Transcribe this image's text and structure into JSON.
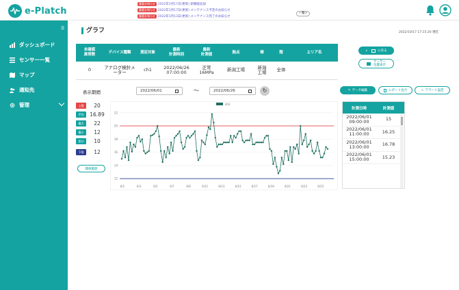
{
  "header": {
    "logo_text": "e-Platch",
    "notices": [
      {
        "tag": "重要お知らせ",
        "text": "2022年1月17日(更新) 新機能追加"
      },
      {
        "tag": "重要お知らせ",
        "text": "2022年1月17日(更新) メンテナンス予定のお知らせ"
      },
      {
        "tag": "重要お知らせ",
        "text": "2022年1月13日(更新) メンテナンス完了のお知らせ"
      }
    ],
    "list_button": "一覧>"
  },
  "sidebar": {
    "items": [
      {
        "label": "ダッシュボード",
        "icon": "bar-chart-icon"
      },
      {
        "label": "センサー一覧",
        "icon": "list-icon"
      },
      {
        "label": "マップ",
        "icon": "map-icon"
      },
      {
        "label": "通知先",
        "icon": "users-icon"
      },
      {
        "label": "管理",
        "icon": "gear-icon"
      }
    ]
  },
  "page": {
    "title": "グラフ",
    "datestamp": "2022/10/17 17:15:20",
    "datestamp_suffix": "現在"
  },
  "device_table": {
    "headers": [
      "未確認\n異常数",
      "デバイス種類",
      "測定対象",
      "最新\n計測時刻",
      "最新\n計測値",
      "拠点",
      "棟",
      "階",
      "エリア名"
    ],
    "row": [
      "0",
      "アナログ検針メーター",
      "ch1",
      "2022/06/26\n07:00:00",
      "正常\n16MPa",
      "新潟工場",
      "新潟\n工場",
      "全体",
      ""
    ]
  },
  "buttons": {
    "back": "に戻る",
    "sensor_location": "サンサー\n位置表示",
    "data_edit": "データ編集",
    "report_output": "レポート出力",
    "alert_setting": "アラート設定",
    "history": "閾値履歴"
  },
  "period": {
    "label": "表示期間",
    "start": "2022/06/01",
    "end": "2022/06/26",
    "separator": "〜"
  },
  "stats": [
    {
      "label": "上限",
      "value": "20",
      "color": "#e34747"
    },
    {
      "label": "平均",
      "value": "16.89",
      "color": "#14a3a0"
    },
    {
      "label": "最大",
      "value": "22",
      "color": "#14a3a0"
    },
    {
      "label": "最小",
      "value": "12",
      "color": "#14a3a0"
    },
    {
      "label": "差分",
      "value": "10",
      "color": "#14a3a0"
    },
    {
      "label": "下限",
      "value": "12",
      "color": "#2b3d8f"
    }
  ],
  "readings_table": {
    "headers": [
      "計測日時",
      "計測値"
    ],
    "rows": [
      {
        "time": "2022/06/01\n09:00:00",
        "value": "15"
      },
      {
        "time": "2022/06/01\n11:00:00",
        "value": "16.25"
      },
      {
        "time": "2022/06/01\n13:00:00",
        "value": "16.78"
      },
      {
        "time": "2022/06/01\n15:00:00",
        "value": "15.23"
      }
    ]
  },
  "chart_data": {
    "type": "line",
    "legend": [
      "ch1"
    ],
    "x_ticks": [
      "6/1",
      "6/3",
      "6/5",
      "6/7",
      "6/9",
      "6/11",
      "6/13",
      "6/15",
      "6/17",
      "6/19",
      "6/21",
      "6/23",
      "6/25"
    ],
    "y_ticks": [
      "12",
      "14",
      "16",
      "18",
      "20",
      "22"
    ],
    "ylim": [
      11.5,
      22.5
    ],
    "upper_limit": 20,
    "lower_limit": 12,
    "series": [
      {
        "name": "ch1",
        "values": [
          15,
          16.2,
          15.2,
          16.8,
          14.8,
          17.5,
          16.1,
          17.2,
          16.8,
          18.2,
          18.5,
          17.6,
          18,
          16.2,
          15.8,
          16,
          16.2,
          18.5,
          18.6,
          18.8,
          19.2,
          20,
          18.4,
          16.2,
          14.5,
          16.2,
          15.2,
          16.8,
          15.8,
          17.5,
          16.2,
          18.2,
          18.5,
          18.8,
          19.2,
          17.5,
          16.5,
          16.8,
          18.2,
          18.5,
          18.2,
          18.5,
          18.8,
          19.2,
          16.2,
          14.8,
          15.2,
          17.8,
          17.5,
          17.2,
          18.6,
          19.8,
          19.5,
          21.8,
          20.5,
          18.2,
          16.8,
          17.2,
          17.2,
          17.2,
          17.5,
          17.5,
          17.5,
          17.5,
          18.5,
          17.5,
          18.5,
          18.2,
          18.8,
          19.2,
          19.2,
          17.8,
          17.5,
          17.8,
          17.8,
          17.8,
          18.8,
          17.2,
          17.2,
          17.5,
          17.5,
          17.5,
          17.5,
          17.5,
          18.2,
          18.5,
          18.5,
          16.5,
          16.2,
          14.2,
          15.2,
          13.8,
          12.8,
          13.2,
          15.2,
          14.2,
          16.2,
          16.2,
          14.8,
          16.8,
          14.5,
          16.8,
          16.5,
          17.2,
          15.8,
          20,
          17.2,
          17.8,
          18.8,
          16.8,
          17.2,
          17.8,
          16.2,
          15.8,
          16.2,
          17.5,
          16.2,
          15.2,
          15.2,
          15.8,
          16.8,
          16.5
        ]
      }
    ]
  }
}
